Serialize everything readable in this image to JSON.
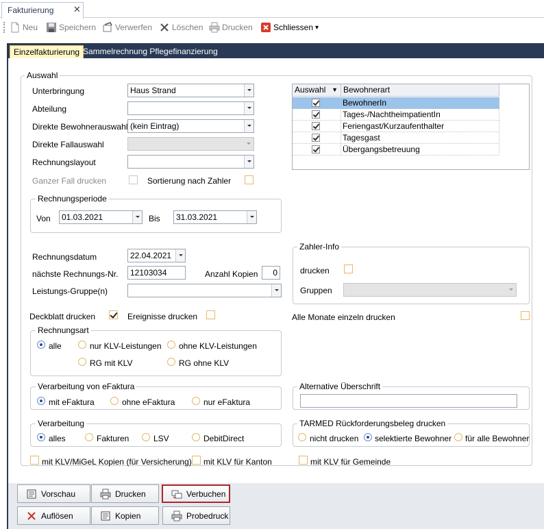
{
  "window_tab": {
    "title": "Fakturierung",
    "close": "✕"
  },
  "toolbar": {
    "new": "Neu",
    "save": "Speichern",
    "discard": "Verwerfen",
    "delete": "Löschen",
    "print": "Drucken",
    "close": "Schliessen"
  },
  "tabs": [
    "Einzelfakturierung",
    "Sammelrechnung Pflegefinanzierung"
  ],
  "auswahl": {
    "title": "Auswahl",
    "unterbringung_label": "Unterbringung",
    "unterbringung_value": "Haus Strand",
    "abteilung_label": "Abteilung",
    "abteilung_value": "",
    "bewohner_label": "Direkte Bewohnerauswahl",
    "bewohner_value": "(kein Eintrag)",
    "fall_label": "Direkte Fallauswahl",
    "layout_label": "Rechnungslayout",
    "layout_value": "",
    "ganzer_fall_label": "Ganzer Fall drucken",
    "sortierung_label": "Sortierung nach Zahler"
  },
  "grid": {
    "col_auswahl": "Auswahl",
    "col_bewohnerart": "Bewohnerart",
    "rows": [
      {
        "label": "BewohnerIn",
        "checked": true
      },
      {
        "label": "Tages-/NachtheimpatientIn",
        "checked": true
      },
      {
        "label": "Feriengast/Kurzaufenthalter",
        "checked": true
      },
      {
        "label": "Tagesgast",
        "checked": true
      },
      {
        "label": "Übergangsbetreuung",
        "checked": true
      }
    ]
  },
  "periode": {
    "title": "Rechnungsperiode",
    "von_label": "Von",
    "von": "01.03.2021",
    "bis_label": "Bis",
    "bis": "31.03.2021"
  },
  "rechnung": {
    "datum_label": "Rechnungsdatum",
    "datum": "22.04.2021",
    "nr_label": "nächste Rechnungs-Nr.",
    "nr": "12103034",
    "kopien_label": "Anzahl Kopien",
    "kopien": "0",
    "gruppe_label": "Leistungs-Gruppe(n)",
    "gruppe": ""
  },
  "zahler": {
    "title": "Zahler-Info",
    "drucken_label": "drucken",
    "gruppen_label": "Gruppen"
  },
  "options": {
    "deckblatt": "Deckblatt drucken",
    "ereignisse": "Ereignisse drucken",
    "alle_monate": "Alle Monate einzeln drucken"
  },
  "rechnungsart": {
    "title": "Rechnungsart",
    "opts": [
      "alle",
      "nur KLV-Leistungen",
      "ohne KLV-Leistungen",
      "RG mit KLV",
      "RG ohne KLV"
    ]
  },
  "efaktura": {
    "title": "Verarbeitung von eFaktura",
    "opts": [
      "mit eFaktura",
      "ohne eFaktura",
      "nur eFaktura"
    ]
  },
  "alt_ueberschrift": {
    "title": "Alternative Überschrift",
    "value": ""
  },
  "verarbeitung": {
    "title": "Verarbeitung",
    "opts": [
      "alles",
      "Fakturen",
      "LSV",
      "DebitDirect"
    ]
  },
  "tarmed": {
    "title": "TARMED Rückforderungsbeleg drucken",
    "opts": [
      "nicht drucken",
      "selektierte Bewohner",
      "für alle Bewohner"
    ]
  },
  "kopien_opts": {
    "klv_migel": "mit KLV/MiGeL Kopien (für Versicherung)",
    "kanton": "mit KLV für Kanton",
    "gemeinde": "mit KLV für Gemeinde"
  },
  "buttons": {
    "vorschau": "Vorschau",
    "drucken": "Drucken",
    "verbuchen": "Verbuchen",
    "aufloesen": "Auflösen",
    "kopien": "Kopien",
    "probedruck": "Probedruck"
  },
  "colors": {
    "frame": "#2a3955",
    "active_tab": "#fff7c8",
    "highlight": "#b0242a",
    "selected_row": "#9cc3ea"
  }
}
